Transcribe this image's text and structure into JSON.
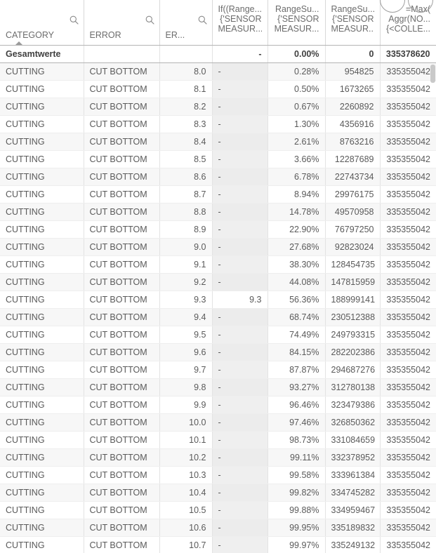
{
  "table": {
    "columns": [
      {
        "id": "category",
        "label": "CATEGORY",
        "type": "dimension",
        "align": "left",
        "search": true,
        "sorted": "asc"
      },
      {
        "id": "error",
        "label": "ERROR",
        "type": "dimension",
        "align": "left",
        "search": true,
        "sorted": "none"
      },
      {
        "id": "ervalue",
        "label": "ER...",
        "type": "dimension",
        "align": "left",
        "search": true,
        "sorted": "none"
      },
      {
        "id": "if_range",
        "label": "If((Range...\n{'SENSOR\nMEASUR...",
        "line1": "If((Range...",
        "line2": "{'SENSOR",
        "line3": "MEASUR...",
        "type": "measure",
        "align": "right"
      },
      {
        "id": "rs_pct",
        "label": "RangeSu...\n{'SENSOR\nMEASUR...",
        "line1": "RangeSu...",
        "line2": "{'SENSOR",
        "line3": "MEASUR...",
        "type": "measure",
        "align": "right"
      },
      {
        "id": "rs_sum",
        "label": "RangeSu...\n{'SENSOR\nMEASUR...",
        "line1": "RangeSu...",
        "line2": "{'SENSOR",
        "line3": "MEASUR...",
        "type": "measure",
        "align": "right"
      },
      {
        "id": "max_aggr",
        "label": "=Max(\nAggr(NO...\n{<COLLE...",
        "line1": "=Max(",
        "line2": "Aggr(NO...",
        "line3": "{<COLLE...",
        "type": "measure",
        "align": "right"
      }
    ],
    "totals_row": {
      "label": "Gesamtwerte",
      "category": "Gesamtwerte",
      "error": "",
      "ervalue": "",
      "if_range": "-",
      "rs_pct": "0.00%",
      "rs_sum": "0",
      "max_aggr": "335378620"
    },
    "rows": [
      {
        "category": "CUTTING",
        "error": "CUT BOTTOM",
        "ervalue": "8.0",
        "if_range": "-",
        "rs_pct": "0.28%",
        "rs_sum": "954825",
        "max_aggr": "335355042"
      },
      {
        "category": "CUTTING",
        "error": "CUT BOTTOM",
        "ervalue": "8.1",
        "if_range": "-",
        "rs_pct": "0.50%",
        "rs_sum": "1673265",
        "max_aggr": "335355042"
      },
      {
        "category": "CUTTING",
        "error": "CUT BOTTOM",
        "ervalue": "8.2",
        "if_range": "-",
        "rs_pct": "0.67%",
        "rs_sum": "2260892",
        "max_aggr": "335355042"
      },
      {
        "category": "CUTTING",
        "error": "CUT BOTTOM",
        "ervalue": "8.3",
        "if_range": "-",
        "rs_pct": "1.30%",
        "rs_sum": "4356916",
        "max_aggr": "335355042"
      },
      {
        "category": "CUTTING",
        "error": "CUT BOTTOM",
        "ervalue": "8.4",
        "if_range": "-",
        "rs_pct": "2.61%",
        "rs_sum": "8763216",
        "max_aggr": "335355042"
      },
      {
        "category": "CUTTING",
        "error": "CUT BOTTOM",
        "ervalue": "8.5",
        "if_range": "-",
        "rs_pct": "3.66%",
        "rs_sum": "12287689",
        "max_aggr": "335355042"
      },
      {
        "category": "CUTTING",
        "error": "CUT BOTTOM",
        "ervalue": "8.6",
        "if_range": "-",
        "rs_pct": "6.78%",
        "rs_sum": "22743734",
        "max_aggr": "335355042"
      },
      {
        "category": "CUTTING",
        "error": "CUT BOTTOM",
        "ervalue": "8.7",
        "if_range": "-",
        "rs_pct": "8.94%",
        "rs_sum": "29976175",
        "max_aggr": "335355042"
      },
      {
        "category": "CUTTING",
        "error": "CUT BOTTOM",
        "ervalue": "8.8",
        "if_range": "-",
        "rs_pct": "14.78%",
        "rs_sum": "49570958",
        "max_aggr": "335355042"
      },
      {
        "category": "CUTTING",
        "error": "CUT BOTTOM",
        "ervalue": "8.9",
        "if_range": "-",
        "rs_pct": "22.90%",
        "rs_sum": "76797250",
        "max_aggr": "335355042"
      },
      {
        "category": "CUTTING",
        "error": "CUT BOTTOM",
        "ervalue": "9.0",
        "if_range": "-",
        "rs_pct": "27.68%",
        "rs_sum": "92823024",
        "max_aggr": "335355042"
      },
      {
        "category": "CUTTING",
        "error": "CUT BOTTOM",
        "ervalue": "9.1",
        "if_range": "-",
        "rs_pct": "38.30%",
        "rs_sum": "128454735",
        "max_aggr": "335355042"
      },
      {
        "category": "CUTTING",
        "error": "CUT BOTTOM",
        "ervalue": "9.2",
        "if_range": "-",
        "rs_pct": "44.08%",
        "rs_sum": "147815959",
        "max_aggr": "335355042"
      },
      {
        "category": "CUTTING",
        "error": "CUT BOTTOM",
        "ervalue": "9.3",
        "if_range": "9.3",
        "rs_pct": "56.36%",
        "rs_sum": "188999141",
        "max_aggr": "335355042",
        "highlighted": true
      },
      {
        "category": "CUTTING",
        "error": "CUT BOTTOM",
        "ervalue": "9.4",
        "if_range": "-",
        "rs_pct": "68.74%",
        "rs_sum": "230512388",
        "max_aggr": "335355042"
      },
      {
        "category": "CUTTING",
        "error": "CUT BOTTOM",
        "ervalue": "9.5",
        "if_range": "-",
        "rs_pct": "74.49%",
        "rs_sum": "249793315",
        "max_aggr": "335355042"
      },
      {
        "category": "CUTTING",
        "error": "CUT BOTTOM",
        "ervalue": "9.6",
        "if_range": "-",
        "rs_pct": "84.15%",
        "rs_sum": "282202386",
        "max_aggr": "335355042"
      },
      {
        "category": "CUTTING",
        "error": "CUT BOTTOM",
        "ervalue": "9.7",
        "if_range": "-",
        "rs_pct": "87.87%",
        "rs_sum": "294687276",
        "max_aggr": "335355042"
      },
      {
        "category": "CUTTING",
        "error": "CUT BOTTOM",
        "ervalue": "9.8",
        "if_range": "-",
        "rs_pct": "93.27%",
        "rs_sum": "312780138",
        "max_aggr": "335355042"
      },
      {
        "category": "CUTTING",
        "error": "CUT BOTTOM",
        "ervalue": "9.9",
        "if_range": "-",
        "rs_pct": "96.46%",
        "rs_sum": "323479386",
        "max_aggr": "335355042"
      },
      {
        "category": "CUTTING",
        "error": "CUT BOTTOM",
        "ervalue": "10.0",
        "if_range": "-",
        "rs_pct": "97.46%",
        "rs_sum": "326850362",
        "max_aggr": "335355042"
      },
      {
        "category": "CUTTING",
        "error": "CUT BOTTOM",
        "ervalue": "10.1",
        "if_range": "-",
        "rs_pct": "98.73%",
        "rs_sum": "331084659",
        "max_aggr": "335355042"
      },
      {
        "category": "CUTTING",
        "error": "CUT BOTTOM",
        "ervalue": "10.2",
        "if_range": "-",
        "rs_pct": "99.11%",
        "rs_sum": "332378952",
        "max_aggr": "335355042"
      },
      {
        "category": "CUTTING",
        "error": "CUT BOTTOM",
        "ervalue": "10.3",
        "if_range": "-",
        "rs_pct": "99.58%",
        "rs_sum": "333961384",
        "max_aggr": "335355042"
      },
      {
        "category": "CUTTING",
        "error": "CUT BOTTOM",
        "ervalue": "10.4",
        "if_range": "-",
        "rs_pct": "99.82%",
        "rs_sum": "334745282",
        "max_aggr": "335355042"
      },
      {
        "category": "CUTTING",
        "error": "CUT BOTTOM",
        "ervalue": "10.5",
        "if_range": "-",
        "rs_pct": "99.88%",
        "rs_sum": "334959467",
        "max_aggr": "335355042"
      },
      {
        "category": "CUTTING",
        "error": "CUT BOTTOM",
        "ervalue": "10.6",
        "if_range": "-",
        "rs_pct": "99.95%",
        "rs_sum": "335189832",
        "max_aggr": "335355042"
      },
      {
        "category": "CUTTING",
        "error": "CUT BOTTOM",
        "ervalue": "10.7",
        "if_range": "-",
        "rs_pct": "99.97%",
        "rs_sum": "335249132",
        "max_aggr": "335355042"
      }
    ]
  },
  "scrollbar": {
    "orientation": "vertical",
    "thumb_position_pct": 4
  },
  "colors": {
    "header_text": "#6c6c6c",
    "cell_text": "#5a5a5a",
    "totals_text": "#404040",
    "row_stripe": "#f7f7f7",
    "measure_column_bg": "#efefef",
    "border": "#e3e3e3",
    "header_border": "#b4b4b4",
    "scrollbar_thumb": "#c9c9c9"
  }
}
